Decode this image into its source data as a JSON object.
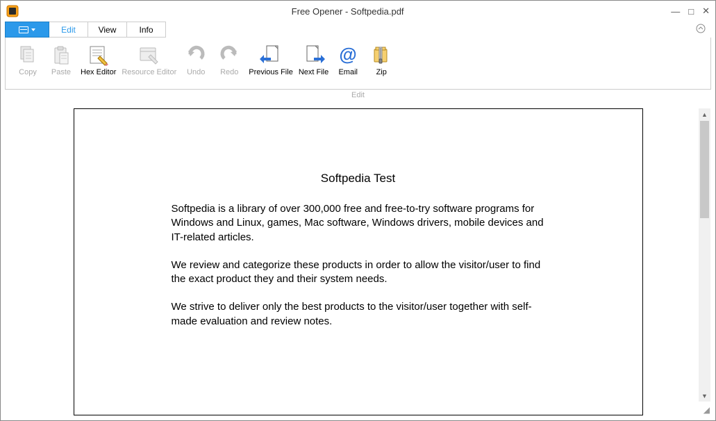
{
  "window": {
    "title": "Free Opener - Softpedia.pdf"
  },
  "tabs": {
    "edit": "Edit",
    "view": "View",
    "info": "Info"
  },
  "ribbon": {
    "copy": "Copy",
    "paste": "Paste",
    "hex_editor": "Hex Editor",
    "resource_editor": "Resource\nEditor",
    "undo": "Undo",
    "redo": "Redo",
    "previous_file": "Previous\nFile",
    "next_file": "Next File",
    "email": "Email",
    "zip": "Zip",
    "group_label": "Edit"
  },
  "document": {
    "title": "Softpedia Test",
    "p1": "Softpedia is a library of over 300,000 free and free-to-try software programs for Windows and Linux, games, Mac software, Windows drivers, mobile devices and IT-related articles.",
    "p2": "We review and categorize these products in order to allow the visitor/user to find the exact product they and their system needs.",
    "p3": "We strive to deliver only the best products to the visitor/user together with self-made evaluation and review notes."
  }
}
